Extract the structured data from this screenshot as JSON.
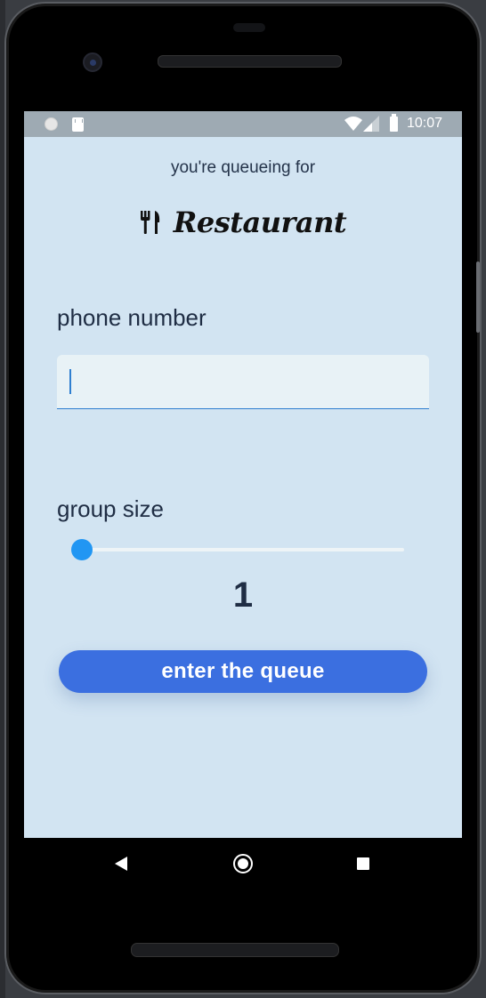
{
  "status_bar": {
    "time": "10:07"
  },
  "header": {
    "queue_label": "you're queueing for",
    "restaurant_name": "Restaurant"
  },
  "form": {
    "phone_label": "phone number",
    "phone_value": "",
    "group_label": "group size",
    "group_size": "1",
    "group_size_slider_fraction": 0,
    "submit_label": "enter the queue"
  },
  "colors": {
    "screen_bg": "#d2e4f2",
    "status_bar_bg": "#9eaab3",
    "accent": "#2196f3",
    "button_bg": "#3b6fe0",
    "text_dark": "#1f2d44"
  },
  "icons": {
    "brand": "utensils-icon",
    "status": [
      "notification-dot-icon",
      "sd-card-icon",
      "wifi-icon",
      "signal-icon",
      "battery-icon"
    ],
    "nav": [
      "back-icon",
      "home-icon",
      "recents-icon"
    ]
  }
}
